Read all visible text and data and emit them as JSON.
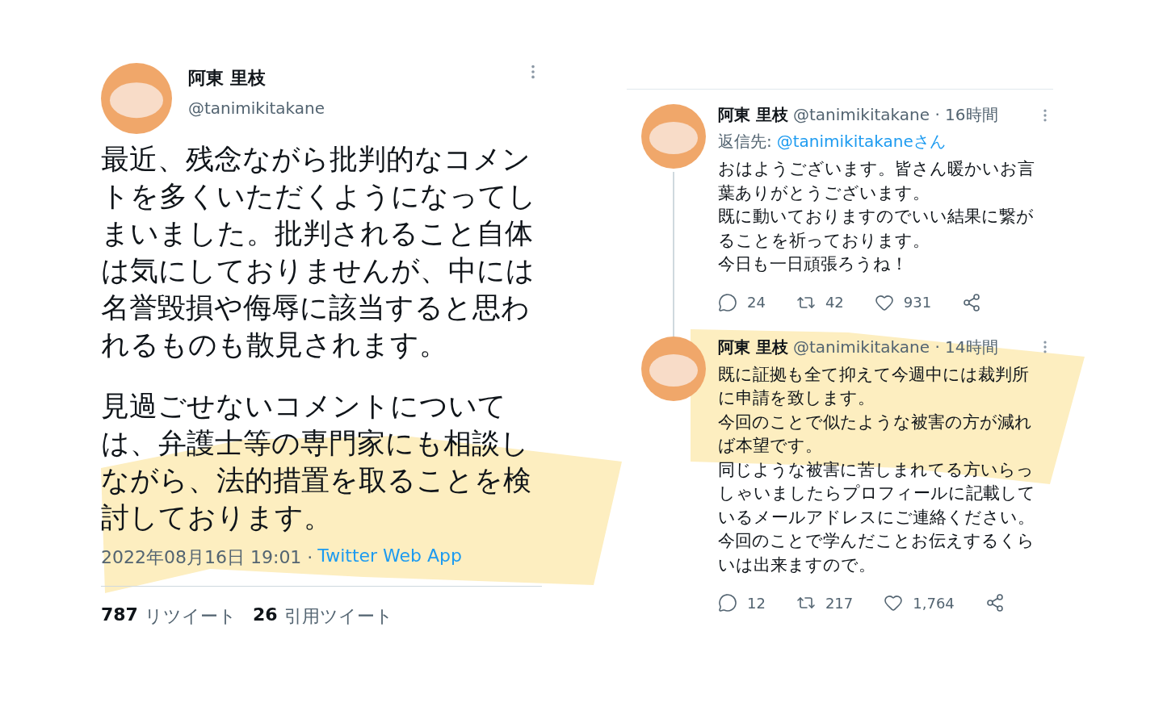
{
  "main_tweet": {
    "author": {
      "name": "阿東 里枝",
      "handle": "@tanimikitakane"
    },
    "paragraphs": [
      [
        "最近、残念ながら批判的なコメン",
        "トを多くいただくようになってし",
        "まいました。批判されること自体",
        "は気にしておりませんが、中には",
        "名誉毀損や侮辱に該当すると思わ",
        "れるものも散見されます。"
      ],
      [
        "見過ごせないコメントについて",
        "は、弁護士等の専門家にも相談し",
        "ながら、法的措置を取ることを検",
        "討しております。"
      ]
    ],
    "timestamp": "2022年08月16日 19:01 ·",
    "source": "Twitter Web App",
    "stats": [
      {
        "count": "787",
        "label": "リツイート"
      },
      {
        "count": "26",
        "label": "引用ツイート"
      }
    ]
  },
  "thread": [
    {
      "name": "阿東 里枝",
      "meta": "@tanimikitakane · 16時間",
      "reply_to": {
        "label": "返信先:",
        "target": "@tanimikitakaneさん"
      },
      "lines": [
        "おはようございます。皆さん暖かいお言",
        "葉ありがとうございます。",
        "既に動いておりますのでいい結果に繋が",
        "ることを祈っております。",
        "今日も一日頑張ろうね！"
      ],
      "actions": [
        {
          "kind": "reply",
          "count": "24"
        },
        {
          "kind": "retweet",
          "count": "42"
        },
        {
          "kind": "like",
          "count": "931"
        },
        {
          "kind": "share"
        }
      ]
    },
    {
      "name": "阿東 里枝",
      "meta": "@tanimikitakane · 14時間",
      "lines": [
        "既に証拠も全て抑えて今週中には裁判所",
        "に申請を致します。",
        "今回のことで似たような被害の方が減れ",
        "ば本望です。",
        "同じような被害に苦しまれてる方いらっ",
        "しゃいましたらプロフィールに記載して",
        "いるメールアドレスにご連絡ください。",
        "今回のことで学んだことお伝えするくら",
        "いは出来ますので。"
      ],
      "actions": [
        {
          "kind": "reply",
          "count": "12"
        },
        {
          "kind": "retweet",
          "count": "217"
        },
        {
          "kind": "like",
          "count": "1,764"
        },
        {
          "kind": "share"
        }
      ]
    }
  ]
}
